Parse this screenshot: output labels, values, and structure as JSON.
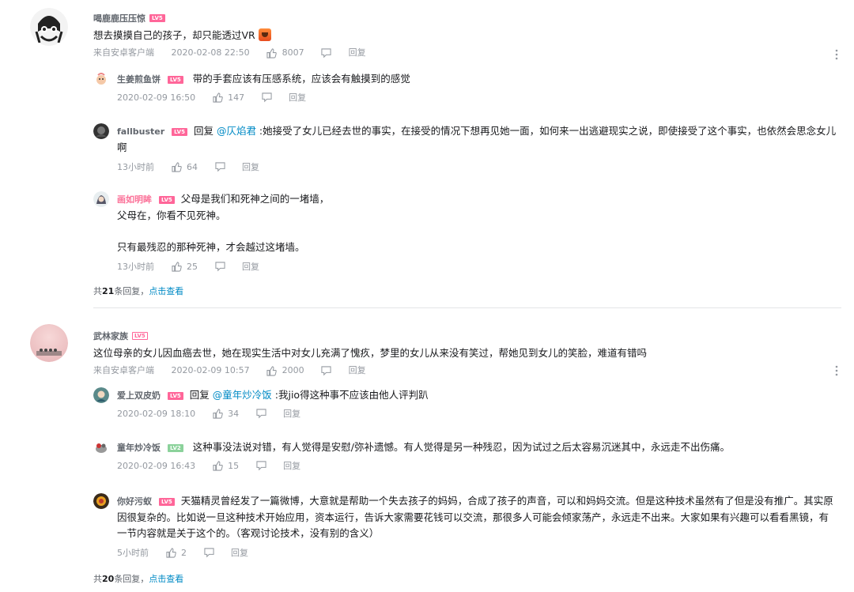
{
  "threads": [
    {
      "user": "喝鹿鹿压压惊",
      "level": "LV5",
      "text": "想去摸摸自己的孩子，却只能透过VR",
      "source": "来自安卓客户端",
      "time": "2020-02-08 22:50",
      "likes": "8007",
      "reply_label": "回复",
      "replies": [
        {
          "user": "生姜煎鱼饼",
          "level": "LV5",
          "prefix": "",
          "mention": "",
          "text": "带的手套应该有压感系统，应该会有触摸到的感觉",
          "time": "2020-02-09 16:50",
          "likes": "147",
          "reply_label": "回复"
        },
        {
          "user": "fallbuster",
          "level": "LV5",
          "prefix": "回复 ",
          "mention": "@仄焰君",
          "text": " :她接受了女儿已经去世的事实，在接受的情况下想再见她一面，如何来一出逃避现实之说，即使接受了这个事实，也依然会思念女儿啊",
          "time": "13小时前",
          "likes": "64",
          "reply_label": "回复"
        },
        {
          "user": "画如明眸",
          "level": "LV5",
          "prefix": "",
          "mention": "",
          "text_lines": [
            "父母是我们和死神之间的一堵墙，",
            "父母在，你看不见死神。",
            "",
            "只有最残忍的那种死神，才会越过这堵墙。"
          ],
          "time": "13小时前",
          "likes": "25",
          "reply_label": "回复"
        }
      ],
      "more": {
        "prefix": "共",
        "count": "21",
        "suffix": "条回复，",
        "link": "点击查看"
      }
    },
    {
      "user": "武林家族",
      "level": "LV5",
      "text": "这位母亲的女儿因血癌去世，她在现实生活中对女儿充满了愧疚，梦里的女儿从来没有笑过，帮她见到女儿的笑脸，难道有错吗",
      "source": "来自安卓客户端",
      "time": "2020-02-09 10:57",
      "likes": "2000",
      "reply_label": "回复",
      "replies": [
        {
          "user": "爱上双皮奶",
          "level": "LV5",
          "prefix": "回复 ",
          "mention": "@童年炒冷饭",
          "text": " :我jio得这种事不应该由他人评判趴",
          "time": "2020-02-09 18:10",
          "likes": "34",
          "reply_label": "回复"
        },
        {
          "user": "童年炒冷饭",
          "level": "LV2",
          "prefix": "",
          "mention": "",
          "text": "这种事没法说对错，有人觉得是安慰/弥补遗憾。有人觉得是另一种残忍，因为试过之后太容易沉迷其中，永远走不出伤痛。",
          "time": "2020-02-09 16:43",
          "likes": "15",
          "reply_label": "回复"
        },
        {
          "user": "你好污蚁",
          "level": "LV5",
          "prefix": "",
          "mention": "",
          "text": "天猫精灵曾经发了一篇微博，大意就是帮助一个失去孩子的妈妈，合成了孩子的声音，可以和妈妈交流。但是这种技术虽然有了但是没有推广。其实原因很复杂的。比如说一旦这种技术开始应用，资本运行，告诉大家需要花钱可以交流，那很多人可能会倾家荡产，永远走不出来。大家如果有兴趣可以看看黑镜，有一节内容就是关于这个的。（客观讨论技术，没有别的含义）",
          "time": "5小时前",
          "likes": "2",
          "reply_label": "回复"
        }
      ],
      "more": {
        "prefix": "共",
        "count": "20",
        "suffix": "条回复，",
        "link": "点击查看"
      }
    }
  ]
}
